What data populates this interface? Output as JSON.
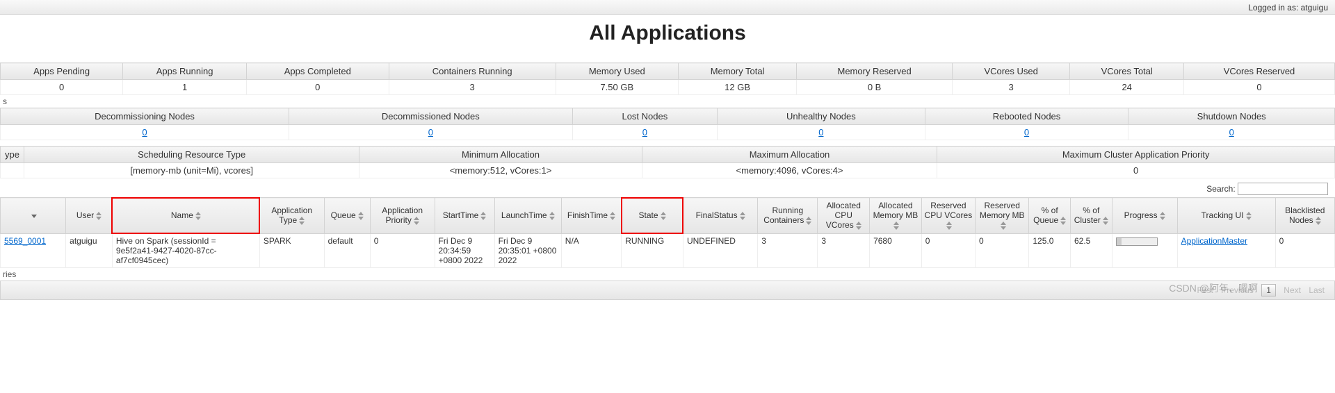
{
  "header": {
    "logged_in_prefix": "Logged in as:",
    "logged_in_user": "atguigu",
    "page_title": "All Applications"
  },
  "cluster_metrics": {
    "headers": [
      "Apps Pending",
      "Apps Running",
      "Apps Completed",
      "Containers Running",
      "Memory Used",
      "Memory Total",
      "Memory Reserved",
      "VCores Used",
      "VCores Total",
      "VCores Reserved"
    ],
    "values": [
      "0",
      "1",
      "0",
      "3",
      "7.50 GB",
      "12 GB",
      "0 B",
      "3",
      "24",
      "0"
    ]
  },
  "section_s": "s",
  "node_metrics": {
    "headers": [
      "Decommissioning Nodes",
      "Decommissioned Nodes",
      "Lost Nodes",
      "Unhealthy Nodes",
      "Rebooted Nodes",
      "Shutdown Nodes"
    ],
    "values": [
      "0",
      "0",
      "0",
      "0",
      "0",
      "0"
    ]
  },
  "scheduler_metrics": {
    "headers": [
      "ype",
      "Scheduling Resource Type",
      "Minimum Allocation",
      "Maximum Allocation",
      "Maximum Cluster Application Priority"
    ],
    "values": [
      "",
      "[memory-mb (unit=Mi), vcores]",
      "<memory:512, vCores:1>",
      "<memory:4096, vCores:4>",
      "0"
    ]
  },
  "search_label": "Search:",
  "apps": {
    "headers": [
      "",
      "User",
      "Name",
      "Application Type",
      "Queue",
      "Application Priority",
      "StartTime",
      "LaunchTime",
      "FinishTime",
      "State",
      "FinalStatus",
      "Running Containers",
      "Allocated CPU VCores",
      "Allocated Memory MB",
      "Reserved CPU VCores",
      "Reserved Memory MB",
      "% of Queue",
      "% of Cluster",
      "Progress",
      "Tracking UI",
      "Blacklisted Nodes"
    ],
    "rows": [
      {
        "id_suffix": "5569_0001",
        "user": "atguigu",
        "name": "Hive on Spark (sessionId = 9e5f2a41-9427-4020-87cc-af7cf0945cec)",
        "app_type": "SPARK",
        "queue": "default",
        "priority": "0",
        "start_time": "Fri Dec 9 20:34:59 +0800 2022",
        "launch_time": "Fri Dec 9 20:35:01 +0800 2022",
        "finish_time": "N/A",
        "state": "RUNNING",
        "final_status": "UNDEFINED",
        "running_containers": "3",
        "alloc_vcores": "3",
        "alloc_mem_mb": "7680",
        "res_vcores": "0",
        "res_mem_mb": "0",
        "pct_queue": "125.0",
        "pct_cluster": "62.5",
        "tracking_ui": "ApplicationMaster",
        "blacklisted": "0"
      }
    ]
  },
  "section_ries": "ries",
  "pager": {
    "first": "First",
    "previous": "Previous",
    "page": "1",
    "next": "Next",
    "last": "Last"
  },
  "watermark": "CSDN @阿年、嗯啊"
}
